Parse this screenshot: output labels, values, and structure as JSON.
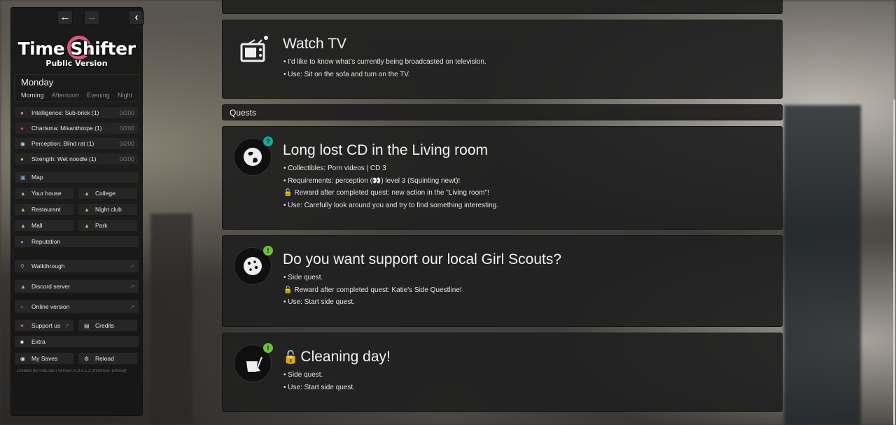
{
  "sidebar": {
    "logo_title": "Time Shifter",
    "logo_subtitle": "Public Version",
    "day": "Monday",
    "periods": [
      "Morning",
      "Afternoon",
      "Evening",
      "Night"
    ],
    "active_period": "Morning",
    "stats": [
      {
        "icon": "brain-icon",
        "label": "Intelligence: Sub-brick (1)",
        "value": "0/200"
      },
      {
        "icon": "lips-icon",
        "label": "Charisma: Misanthrope (1)",
        "value": "0/200"
      },
      {
        "icon": "eyes-icon",
        "label": "Perception: Blind rat (1)",
        "value": "0/200"
      },
      {
        "icon": "muscle-icon",
        "label": "Strength: Wet noodle (1)",
        "value": "0/200"
      }
    ],
    "map_label": "Map",
    "locations": [
      "Your house",
      "College",
      "Restaurant",
      "Night club",
      "Mall",
      "Park"
    ],
    "reputation_label": "Reputation",
    "links": [
      "Walkthrough",
      "Discord server",
      "Online version"
    ],
    "support_label": "Support us",
    "credits_label": "Credits",
    "extra_label": "Extra",
    "saves_label": "My Saves",
    "reload_label": "Reload",
    "footer": "Created by HotLoad | Version: 0.9.0.1.2 (Interface: Default)"
  },
  "main": {
    "watch_tv": {
      "title": "Watch TV",
      "lines": [
        "• I'd like to know what's currently being broadcasted on television.",
        "• Use: Sit on the sofa and turn on the TV."
      ]
    },
    "quests_header": "Quests",
    "quests": [
      {
        "title": "Long lost CD in the Living room",
        "icon": "question-globe-icon",
        "lines": [
          "• Collectibles: Porn videos | CD 3",
          "• Requirements: perception (👀) level 3 (Squinting newt)!"
        ],
        "reward": "Reward after completed quest: new action in the \"Living room\"!",
        "use": "• Use: Carefully look around you and try to find something interesting."
      },
      {
        "title": "Do you want support our local Girl Scouts?",
        "icon": "cookie-icon",
        "lines": [
          "• Side quest."
        ],
        "reward": "Reward after completed quest: Katie's Side Questline!",
        "use": "• Use: Start side quest."
      },
      {
        "title": "Cleaning day!",
        "icon": "cleaning-bucket-icon",
        "lines": [
          "• Side quest."
        ],
        "use": "• Use: Start side quest."
      }
    ]
  },
  "colors": {
    "accent_pink": "#e0567a",
    "badge_teal": "#1fa89b",
    "badge_green": "#6ac13d",
    "lock_orange": "#e8a63b"
  }
}
